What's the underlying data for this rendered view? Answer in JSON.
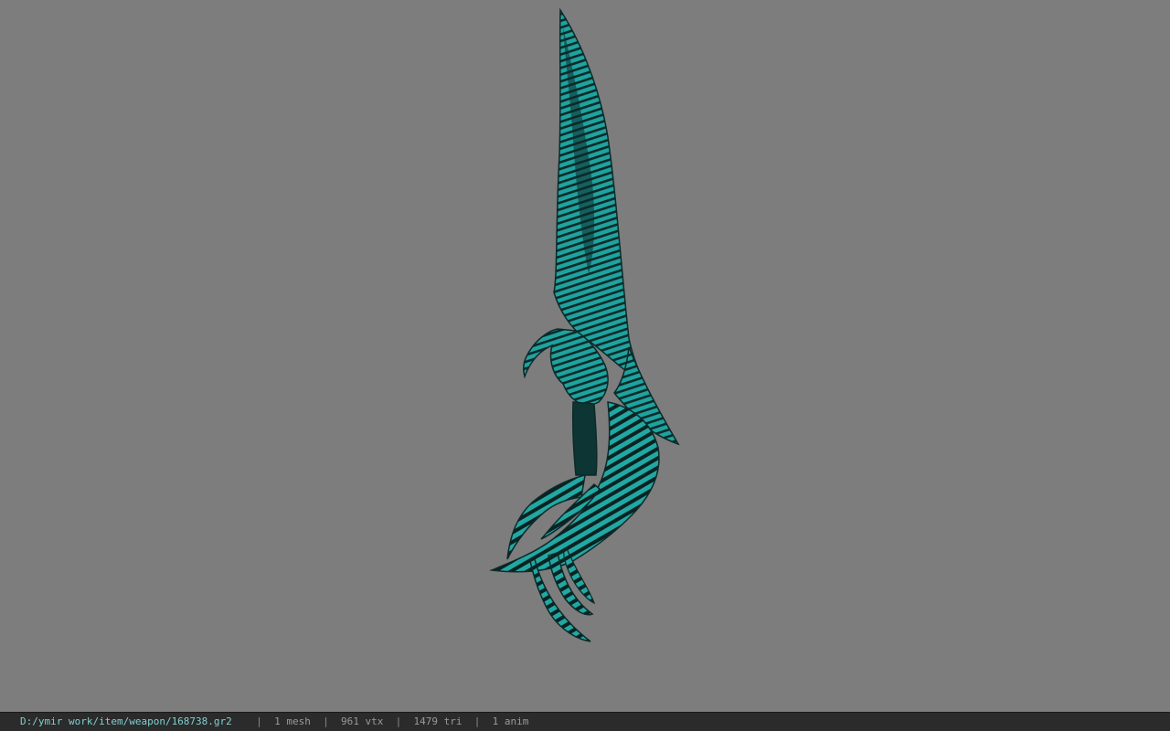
{
  "status_bar": {
    "file_path": "D:/ymir work/item/weapon/168738.gr2",
    "separator": "|",
    "mesh_count": "1 mesh",
    "vertex_count": "961 vtx",
    "triangle_count": "1479 tri",
    "anim_count": "1 anim"
  },
  "viewport": {
    "background_color": "#7d7d7d",
    "model_color": "#1fa39f",
    "model_dark_color": "#0b2a29"
  }
}
